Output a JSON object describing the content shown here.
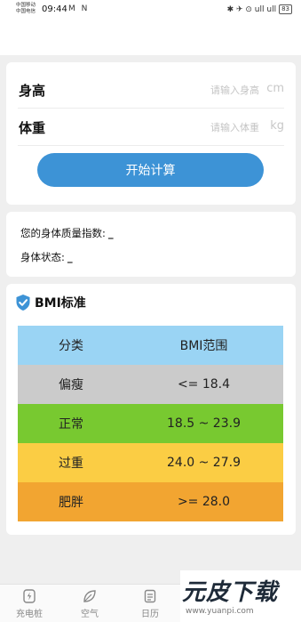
{
  "status_bar": {
    "carrier1": "中国移动",
    "carrier2": "中国电信",
    "time": "09:44",
    "left_icons": "M N",
    "right_icons": "✱ ✈ ⊙ ull ull",
    "battery": "83"
  },
  "form": {
    "height_label": "身高",
    "height_placeholder": "请输入身高",
    "height_unit": "cm",
    "weight_label": "体重",
    "weight_placeholder": "请输入体重",
    "weight_unit": "kg",
    "calc_button": "开始计算"
  },
  "result": {
    "bmi_label": "您的身体质量指数:",
    "bmi_value": "_",
    "status_label": "身体状态:",
    "status_value": "_"
  },
  "standard": {
    "title": "BMI标准",
    "header": {
      "category": "分类",
      "range": "BMI范围"
    },
    "rows": [
      {
        "category": "偏瘦",
        "range": "<= 18.4",
        "color": "#cbcbcb"
      },
      {
        "category": "正常",
        "range": "18.5 ~ 23.9",
        "color": "#78c930"
      },
      {
        "category": "过重",
        "range": "24.0 ~ 27.9",
        "color": "#fbcd44"
      },
      {
        "category": "肥胖",
        "range": ">= 28.0",
        "color": "#f2a531"
      }
    ],
    "header_color": "#9ad4f4",
    "accent_color": "#3d93d6"
  },
  "tabbar": {
    "items": [
      {
        "label": "充电桩",
        "icon": "charging-icon"
      },
      {
        "label": "空气",
        "icon": "leaf-icon"
      },
      {
        "label": "日历",
        "icon": "calendar-icon"
      }
    ]
  },
  "watermark": {
    "brand": "元皮下载",
    "url": "www.yuanpi.com"
  }
}
